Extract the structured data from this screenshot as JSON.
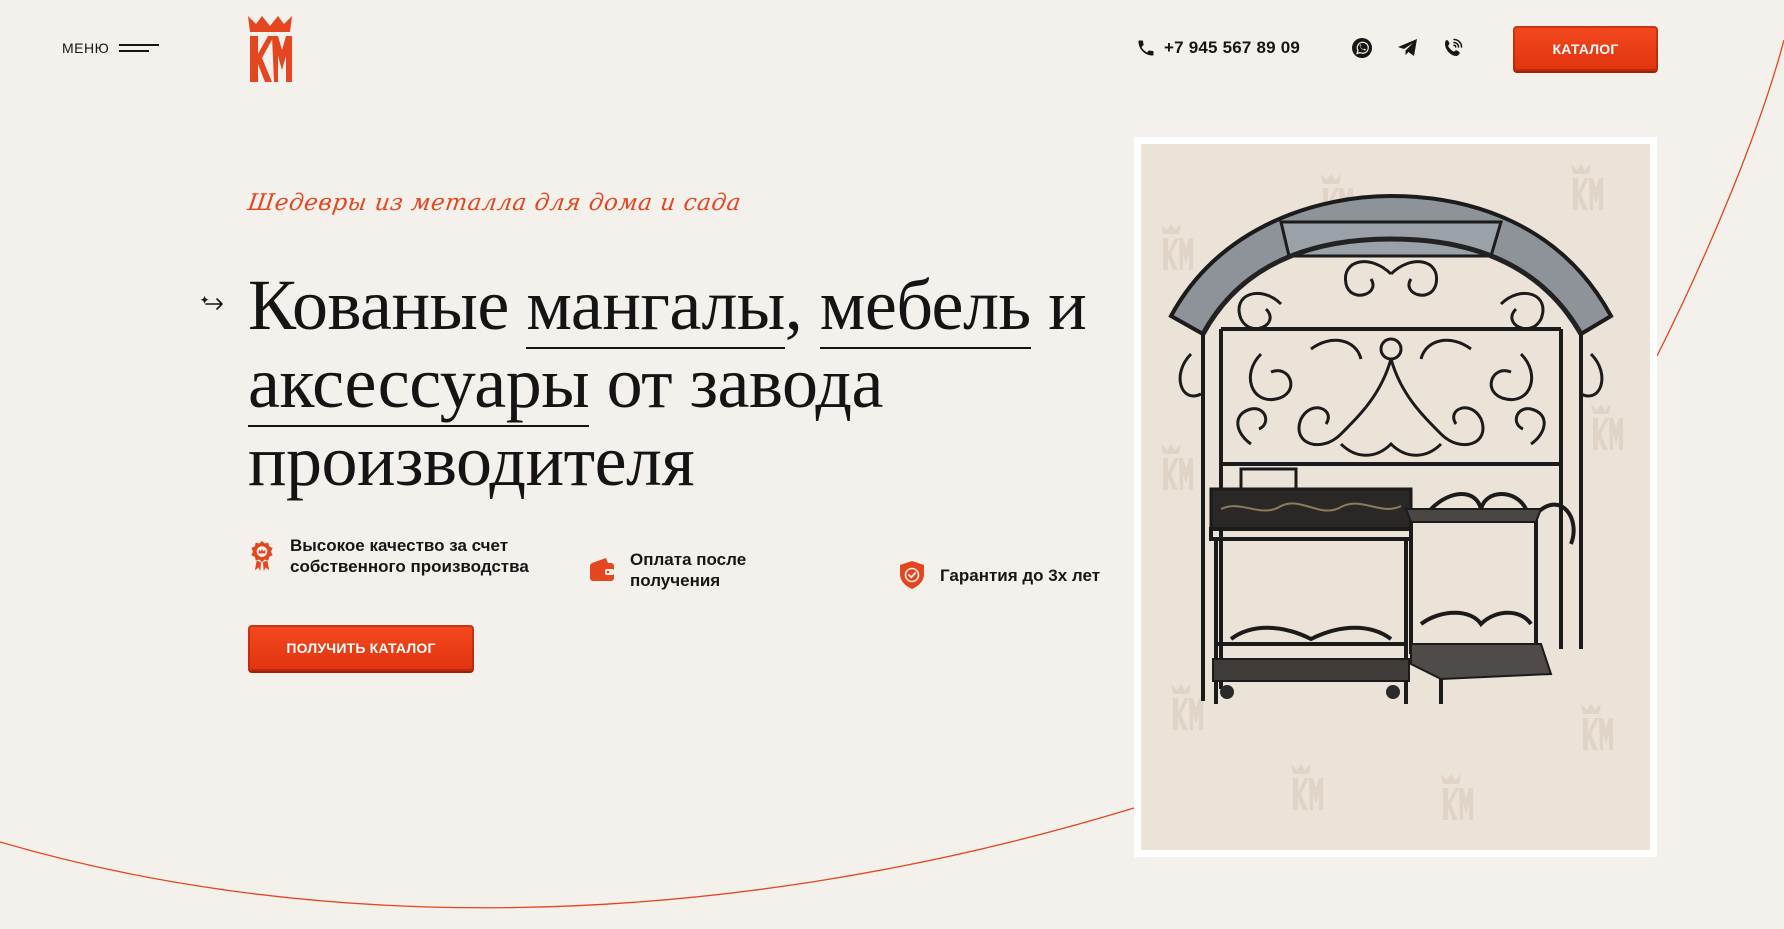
{
  "header": {
    "menu_label": "МЕНЮ",
    "logo_text": "КМ",
    "phone": "+7 945 567 89 09",
    "catalog_button": "КАТАЛОГ",
    "social_icons": [
      "whatsapp-icon",
      "telegram-icon",
      "viber-icon"
    ]
  },
  "hero": {
    "tagline": "Шедевры из металла для дома и сада",
    "title_w1": "Кованые",
    "title_u1": "мангалы",
    "title_sep1": ",",
    "title_u2": "мебель",
    "title_w2": "и",
    "title_u3": "аксессуары",
    "title_w3": "от завода",
    "title_w4": "производителя",
    "features": [
      {
        "icon": "quality-badge-icon",
        "text": "Высокое качество за счет собственного производства"
      },
      {
        "icon": "wallet-icon",
        "text": "Оплата после получения"
      },
      {
        "icon": "shield-check-icon",
        "text": "Гарантия до 3х лет"
      }
    ],
    "cta_button": "ПОЛУЧИТЬ КАТАЛОГ"
  },
  "colors": {
    "background": "#f4f0eb",
    "accent": "#e4461f",
    "text": "#161616",
    "product_bg": "#ebe2d8"
  }
}
